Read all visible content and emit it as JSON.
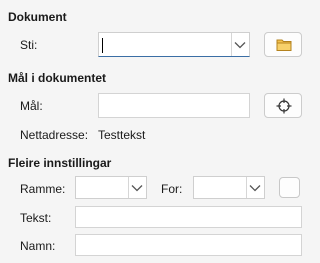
{
  "document_section": {
    "title": "Dokument",
    "path_label": "Sti:",
    "path_value": "",
    "browse_icon": "folder-icon"
  },
  "target_section": {
    "title": "Mål i dokumentet",
    "target_label": "Mål:",
    "target_value": "",
    "target_icon": "crosshair-icon",
    "url_label": "Nettadresse:",
    "url_value": "Testtekst"
  },
  "settings_section": {
    "title": "Fleire innstillingar",
    "frame_label": "Ramme:",
    "frame_value": "",
    "form_label": "For:",
    "form_value": "",
    "text_label": "Tekst:",
    "text_value": "",
    "name_label": "Namn:",
    "name_value": ""
  },
  "colors": {
    "accent": "#3a6ea5",
    "folder": "#e8b339"
  }
}
